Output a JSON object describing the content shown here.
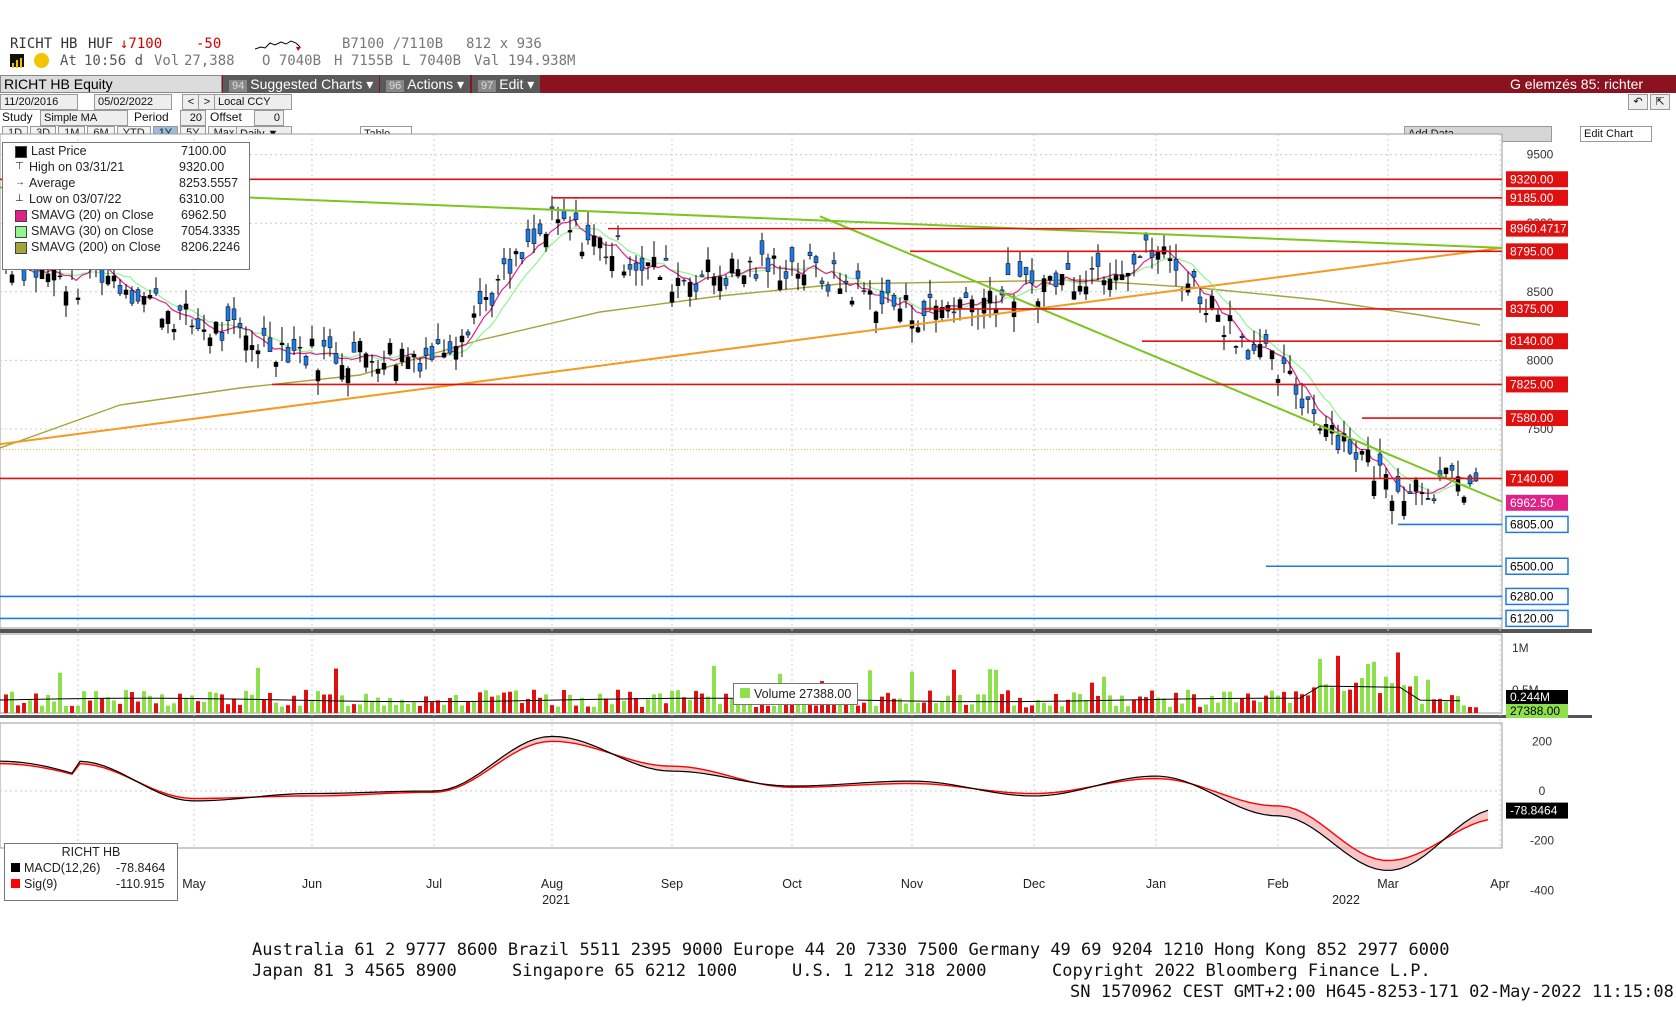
{
  "header": {
    "ticker": "RICHT HB",
    "currency": "HUF",
    "last": "↓7100",
    "change": "-50",
    "bidask": "B7100 /7110B",
    "size": "812 x 936",
    "at": "At",
    "time": "10:56 d",
    "vol_label": "Vol",
    "vol": "27,388",
    "open": "O 7040B",
    "high": "H 7155B",
    "low": "L 7040B",
    "val_label": "Val",
    "val": "194.938M"
  },
  "menubar": {
    "security": "RICHT HB Equity",
    "buttons": [
      {
        "num": "94",
        "label": "Suggested Charts ▾"
      },
      {
        "num": "96",
        "label": "Actions ▾"
      },
      {
        "num": "97",
        "label": "Edit ▾"
      }
    ],
    "right_title": "G elemzés 85: richter"
  },
  "controls": {
    "date_from": "11/20/2016",
    "date_to": "05/02/2022",
    "currency": "Local CCY",
    "study_label": "Study",
    "study": "Simple MA",
    "period_label": "Period",
    "period": "20",
    "offset_label": "Offset",
    "offset": "0",
    "ranges": [
      "1D",
      "3D",
      "1M",
      "6M",
      "YTD",
      "1Y",
      "5Y",
      "Max"
    ],
    "active_range": "1Y",
    "frequency": "Daily ▼",
    "table": "Table",
    "add_data": "Add Data",
    "edit_chart": "Edit Chart"
  },
  "legend": [
    {
      "label": "Last Price",
      "value": "7100.00",
      "color": "#000000"
    },
    {
      "label": "High on 03/31/21",
      "value": "9320.00",
      "color": ""
    },
    {
      "label": "Average",
      "value": "8253.5557",
      "color": ""
    },
    {
      "label": "Low on 03/07/22",
      "value": "6310.00",
      "color": ""
    },
    {
      "label": "SMAVG (20)  on Close",
      "value": "6962.50",
      "color": "#e0218a"
    },
    {
      "label": "SMAVG (30)  on Close",
      "value": "7054.3335",
      "color": "#8ff58f"
    },
    {
      "label": "SMAVG (200)  on Close",
      "value": "8206.2246",
      "color": "#a6a23a"
    }
  ],
  "volume_legend": "Volume  27388.00",
  "macd_legend": {
    "title": "RICHT HB",
    "rows": [
      {
        "label": "MACD(12,26)",
        "value": "-78.8464",
        "color": "#000000"
      },
      {
        "label": "Sig(9)",
        "value": "-110.915",
        "color": "#ff0000"
      }
    ]
  },
  "chart_data": [
    {
      "type": "candlestick",
      "title": "RICHT HB Equity",
      "x_ticks": [
        "Apr",
        "May",
        "Jun",
        "Jul",
        "Aug",
        "Sep",
        "Oct",
        "Nov",
        "Dec",
        "Jan",
        "Feb",
        "Mar",
        "Apr"
      ],
      "year_labels": [
        "2021",
        "2022"
      ],
      "y_ticks": [
        7500,
        8000,
        8500,
        9000,
        9500
      ],
      "ylim": [
        6050,
        9650
      ],
      "horizontal_levels": {
        "resistance_red": [
          9320,
          9185,
          8960.4717,
          8795,
          8375,
          8140,
          7825,
          7580,
          7140
        ],
        "support_blue": [
          6805,
          6500,
          6280,
          6120
        ]
      },
      "right_tags": [
        "9320.00",
        "9185.00",
        "8960.4717",
        "8795.00",
        "8375.00",
        "8140.00",
        "7825.00",
        "7580.00",
        "7140.00",
        "6962.50",
        "6805.00",
        "6500.00",
        "6280.00",
        "6120.00"
      ],
      "close_series_approx": {
        "months": [
          "Apr",
          "May",
          "Jun",
          "Jul",
          "Aug",
          "Sep",
          "Oct",
          "Nov",
          "Dec",
          "Jan",
          "Feb",
          "Mar",
          "Apr"
        ],
        "close": [
          8750,
          8250,
          8050,
          8050,
          9000,
          8600,
          8700,
          8350,
          8550,
          8800,
          7900,
          7100,
          7100
        ]
      },
      "last_price": 7100,
      "sma20": 6962.5,
      "sma30": 7054.3335,
      "sma200": 8206.2246,
      "colors": {
        "up": "#000000",
        "down": "#1f7ae0",
        "resistance": "#e01010",
        "support": "#1f7ae0",
        "sma20": "#e0218a",
        "sma30": "#8ff58f",
        "sma200": "#a6a23a",
        "trend_green": "#7cc520",
        "trend_orange": "#f59a20"
      }
    },
    {
      "type": "bar",
      "title": "Volume",
      "y_ticks": [
        "0.5M",
        "1M"
      ],
      "right_tags": [
        "0.244M",
        "27388.00"
      ],
      "last_volume": 27388,
      "volume_avg": 244000
    },
    {
      "type": "line",
      "title": "MACD",
      "y_ticks": [
        -400,
        -200,
        0,
        200
      ],
      "right_tag": "-78.8464",
      "series": [
        {
          "name": "MACD(12,26)",
          "values_by_month": [
            120,
            -40,
            -10,
            0,
            220,
            80,
            20,
            40,
            -20,
            60,
            -100,
            -320,
            -70
          ]
        },
        {
          "name": "Sig(9)",
          "values_by_month": [
            110,
            -30,
            -20,
            -5,
            200,
            100,
            15,
            30,
            -10,
            50,
            -60,
            -280,
            -110.915
          ]
        }
      ]
    }
  ],
  "footer": {
    "line1": "Australia 61 2 9777 8600 Brazil 5511 2395 9000 Europe 44 20 7330 7500 Germany 49 69 9204 1210 Hong Kong 852 2977 6000",
    "line2a": "Japan 81 3 4565 8900",
    "line2b": "Singapore 65 6212 1000",
    "line2c": "U.S. 1 212 318 2000",
    "line2d": "Copyright 2022 Bloomberg Finance L.P.",
    "line3": "SN 1570962 CEST GMT+2:00 H645-8253-171 02-May-2022 11:15:08"
  }
}
